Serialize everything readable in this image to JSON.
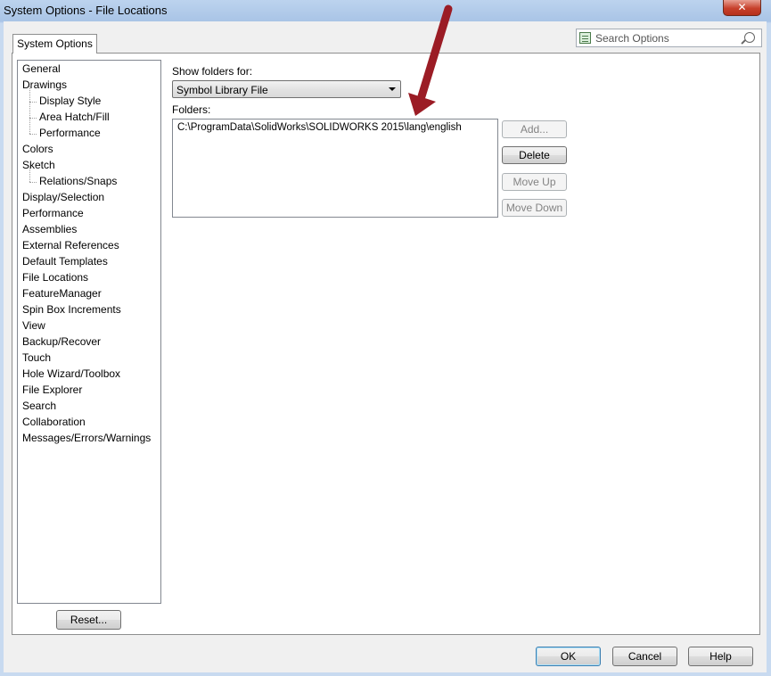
{
  "window": {
    "title": "System Options - File Locations",
    "close_glyph": "✕"
  },
  "tabs": [
    {
      "label": "System Options"
    }
  ],
  "search": {
    "placeholder": "Search Options"
  },
  "tree": {
    "items": [
      {
        "label": "General",
        "level": 0
      },
      {
        "label": "Drawings",
        "level": 0
      },
      {
        "label": "Display Style",
        "level": 1
      },
      {
        "label": "Area Hatch/Fill",
        "level": 1
      },
      {
        "label": "Performance",
        "level": 1
      },
      {
        "label": "Colors",
        "level": 0
      },
      {
        "label": "Sketch",
        "level": 0
      },
      {
        "label": "Relations/Snaps",
        "level": 1
      },
      {
        "label": "Display/Selection",
        "level": 0
      },
      {
        "label": "Performance",
        "level": 0
      },
      {
        "label": "Assemblies",
        "level": 0
      },
      {
        "label": "External References",
        "level": 0
      },
      {
        "label": "Default Templates",
        "level": 0
      },
      {
        "label": "File Locations",
        "level": 0
      },
      {
        "label": "FeatureManager",
        "level": 0
      },
      {
        "label": "Spin Box Increments",
        "level": 0
      },
      {
        "label": "View",
        "level": 0
      },
      {
        "label": "Backup/Recover",
        "level": 0
      },
      {
        "label": "Touch",
        "level": 0
      },
      {
        "label": "Hole Wizard/Toolbox",
        "level": 0
      },
      {
        "label": "File Explorer",
        "level": 0
      },
      {
        "label": "Search",
        "level": 0
      },
      {
        "label": "Collaboration",
        "level": 0
      },
      {
        "label": "Messages/Errors/Warnings",
        "level": 0
      }
    ],
    "selected": "File Locations"
  },
  "reset_label": "Reset...",
  "show_folders": {
    "label": "Show folders for:",
    "value": "Symbol Library File"
  },
  "folders": {
    "label": "Folders:",
    "entries": [
      "C:\\ProgramData\\SolidWorks\\SOLIDWORKS 2015\\lang\\english"
    ]
  },
  "side_buttons": {
    "add": "Add...",
    "delete": "Delete",
    "move_up": "Move Up",
    "move_down": "Move Down"
  },
  "footer": {
    "ok": "OK",
    "cancel": "Cancel",
    "help": "Help"
  },
  "annotation_arrow_color": "#9b1c25"
}
